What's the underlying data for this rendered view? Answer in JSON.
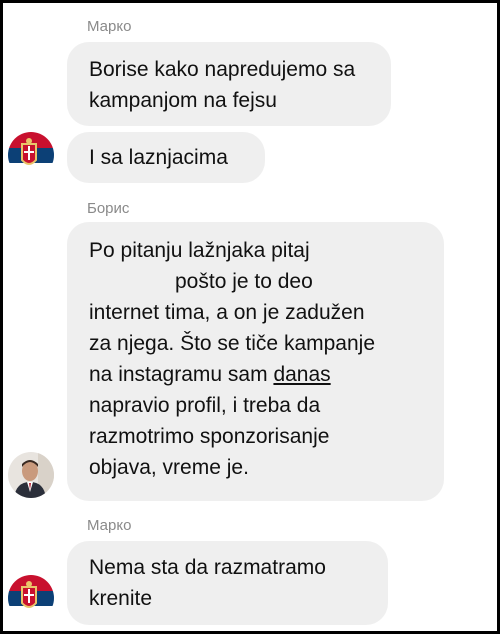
{
  "chat": {
    "messages": [
      {
        "sender": "Марко",
        "lines": [
          "Borise kako napredujemo sa",
          "kampanjom na fejsu"
        ]
      },
      {
        "lines": [
          "I sa laznjacima"
        ],
        "avatar": "serbian-flag-coat-of-arms-avatar"
      },
      {
        "sender": "Борис",
        "lines": [
          "Po pitanju lažnjaka pitaj",
          "pošto je to deo",
          "internet tima, a on je zadužen",
          "za njega. Što se tiče kampanje",
          "na instagramu sam",
          "danas",
          "napravio profil, i treba da",
          "razmotrimo sponzorisanje",
          "objava, vreme je."
        ],
        "avatar": "man-portrait-avatar"
      },
      {
        "sender": "Марко",
        "lines": [
          "Nema sta da razmatramo",
          "krenite"
        ],
        "avatar": "serbian-flag-coat-of-arms-avatar"
      }
    ]
  },
  "colors": {
    "bubble": "#efefef",
    "sender_text": "#8a8a8a",
    "message_text": "#111111",
    "frame_border": "#000000"
  }
}
